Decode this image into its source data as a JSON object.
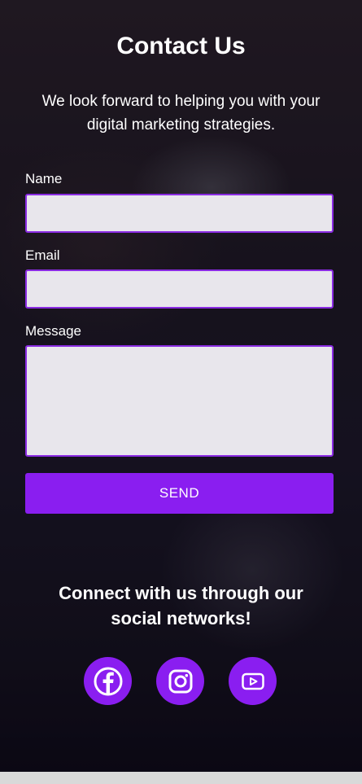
{
  "page": {
    "title": "Contact Us",
    "subtitle": "We look forward to helping you with your digital marketing strategies."
  },
  "form": {
    "name_label": "Name",
    "name_value": "",
    "email_label": "Email",
    "email_value": "",
    "message_label": "Message",
    "message_value": "",
    "send_label": "SEND"
  },
  "social": {
    "heading": "Connect with us through our social networks!",
    "links": [
      {
        "icon": "facebook-icon"
      },
      {
        "icon": "instagram-icon"
      },
      {
        "icon": "youtube-icon"
      }
    ]
  },
  "colors": {
    "accent": "#8a1ef0",
    "field_border": "#8a2be2",
    "field_bg": "#e8e6ec",
    "text": "#ffffff"
  }
}
